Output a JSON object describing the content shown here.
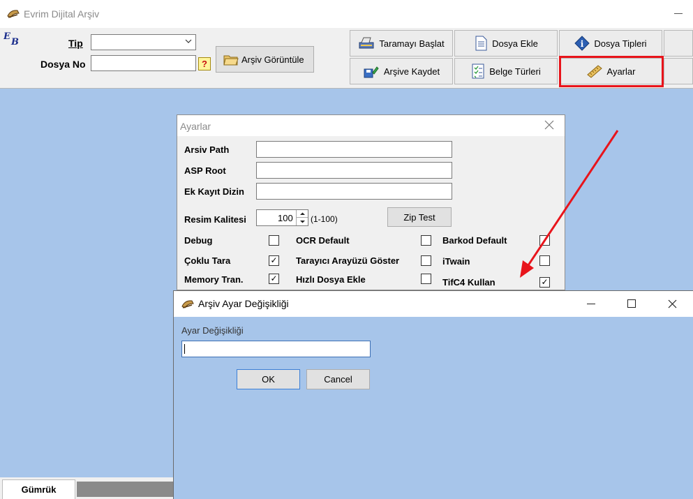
{
  "main_window": {
    "title": "Evrim Dijital Arşiv"
  },
  "search": {
    "tip_label": "Tip",
    "dosya_no_label": "Dosya No",
    "help_glyph": "?",
    "arsiv_goruntule": "Arşiv Görüntüle"
  },
  "toolbar": {
    "taramayi_baslat": "Taramayı Başlat",
    "dosya_ekle": "Dosya Ekle",
    "dosya_tipleri": "Dosya Tipleri",
    "arsive_kaydet": "Arşive Kaydet",
    "belge_turleri": "Belge Türleri",
    "ayarlar": "Ayarlar"
  },
  "ayarlar_dialog": {
    "title": "Ayarlar",
    "arsiv_path": "Arsiv Path",
    "asp_root": "ASP Root",
    "ek_kayit_dizin": "Ek Kayıt Dizin",
    "resim_kalitesi": "Resim Kalitesi",
    "resim_kalitesi_value": "100",
    "resim_range": "(1-100)",
    "zip_test": "Zip Test",
    "checks": {
      "debug": "Debug",
      "ocr_default": "OCR Default",
      "barkod_default": "Barkod Default",
      "coklu_tara": "Çoklu Tara",
      "tarayici_arayuzu": "Tarayıcı Arayüzü Göster",
      "itwain": "iTwain",
      "memory_tran": "Memory Tran.",
      "hizli_dosya_ekle": "Hızlı Dosya Ekle",
      "tifc4_kullan": "TifC4 Kullan"
    },
    "checked_glyph": "✓"
  },
  "change_dialog": {
    "title": "Arşiv Ayar Değişikliği",
    "field_label": "Ayar Değişikliği",
    "ok": "OK",
    "cancel": "Cancel"
  },
  "bottom_tab": {
    "label": "Gümrük"
  },
  "colors": {
    "highlight": "#e8141b",
    "arrow": "#e8141b",
    "background": "#a7c5ea"
  }
}
